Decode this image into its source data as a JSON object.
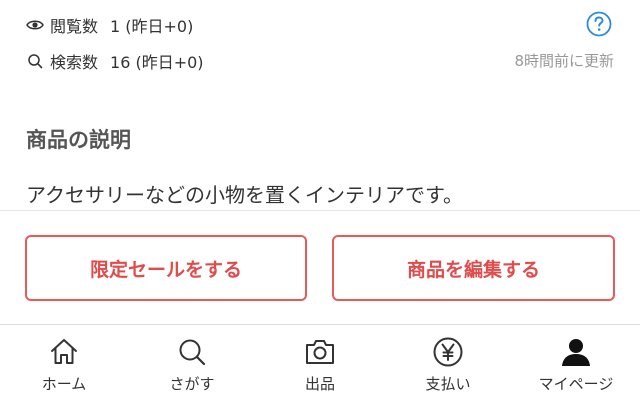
{
  "stats": {
    "views_label": "閲覧数",
    "views_value": "1 (昨日+0)",
    "search_label": "検索数",
    "search_value": "16 (昨日+0)",
    "updated_text": "8時間前に更新"
  },
  "description": {
    "title": "商品の説明",
    "body": "アクセサリーなどの小物を置くインテリアです。"
  },
  "actions": {
    "sale_label": "限定セールをする",
    "edit_label": "商品を編集する"
  },
  "tabbar": {
    "items": [
      {
        "label": "ホーム",
        "icon": "home-icon"
      },
      {
        "label": "さがす",
        "icon": "search-icon"
      },
      {
        "label": "出品",
        "icon": "camera-icon"
      },
      {
        "label": "支払い",
        "icon": "yen-icon"
      },
      {
        "label": "マイページ",
        "icon": "person-icon"
      }
    ]
  },
  "colors": {
    "accent": "#e04c4c",
    "help": "#2e8bd8",
    "muted": "#999999"
  }
}
